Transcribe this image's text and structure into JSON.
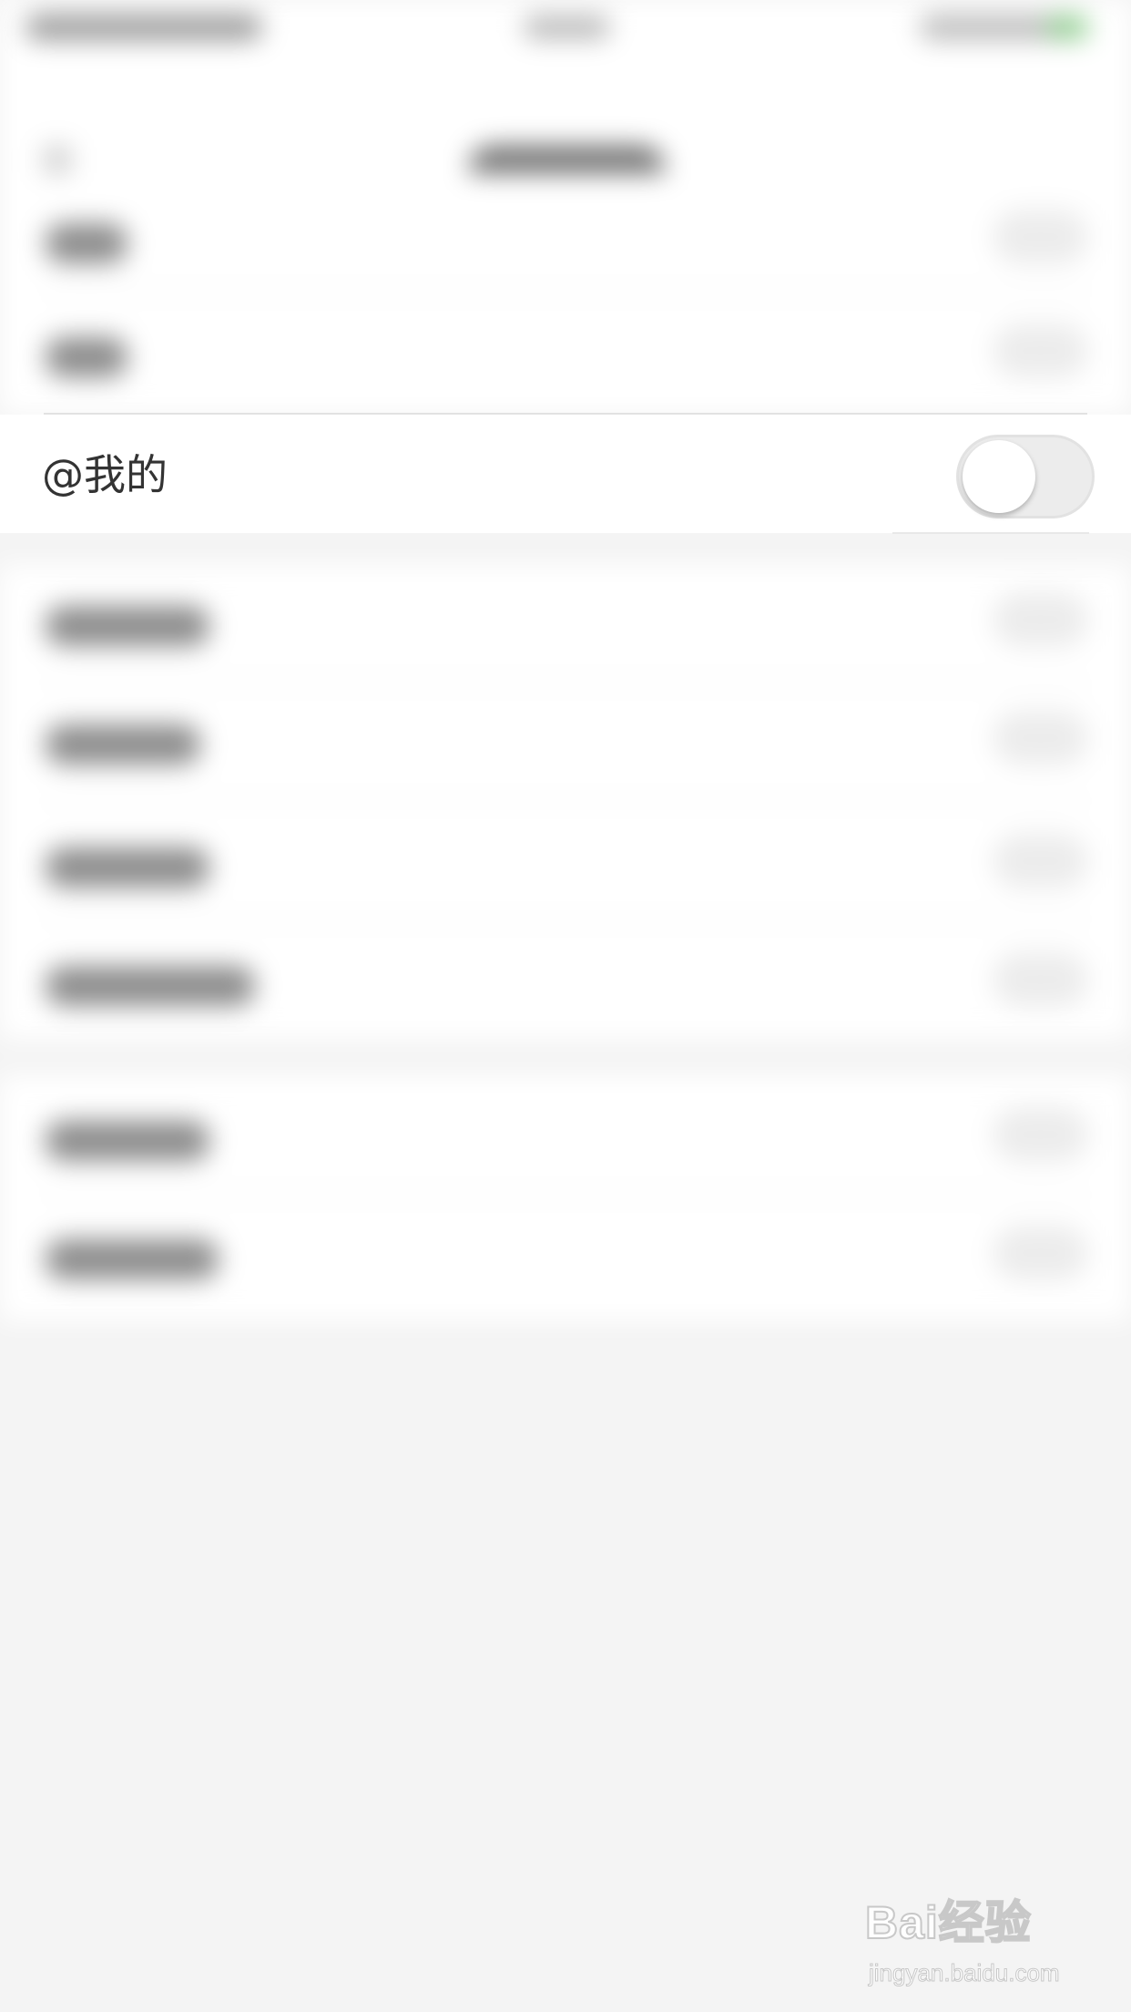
{
  "settings_row": {
    "label": "@我的",
    "toggle_on": false
  },
  "watermark": {
    "logo_text": "Bai经验",
    "url_text": "jingyan.baidu.com"
  },
  "colors": {
    "background": "#f4f4f4",
    "row_background": "#ffffff",
    "label_text": "#333333",
    "toggle_off_track": "#ececec"
  }
}
